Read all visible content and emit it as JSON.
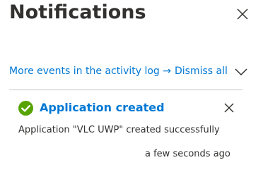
{
  "panel": {
    "title": "Notifications",
    "close_icon": "close-icon"
  },
  "toolbar": {
    "activity_log_link": "More events in the activity log →",
    "dismiss_all": "Dismiss all",
    "chevron_icon": "chevron-down-icon"
  },
  "notifications": [
    {
      "status": "success",
      "status_icon": "success-check-icon",
      "title": "Application created",
      "message": "Application \"VLC UWP\" created successfully",
      "time": "a few seconds ago",
      "dismiss_icon": "close-icon"
    }
  ],
  "colors": {
    "link": "#0078d4",
    "success": "#57a300",
    "text": "#323130",
    "divider": "#c8c6c4",
    "background": "#ffffff"
  }
}
